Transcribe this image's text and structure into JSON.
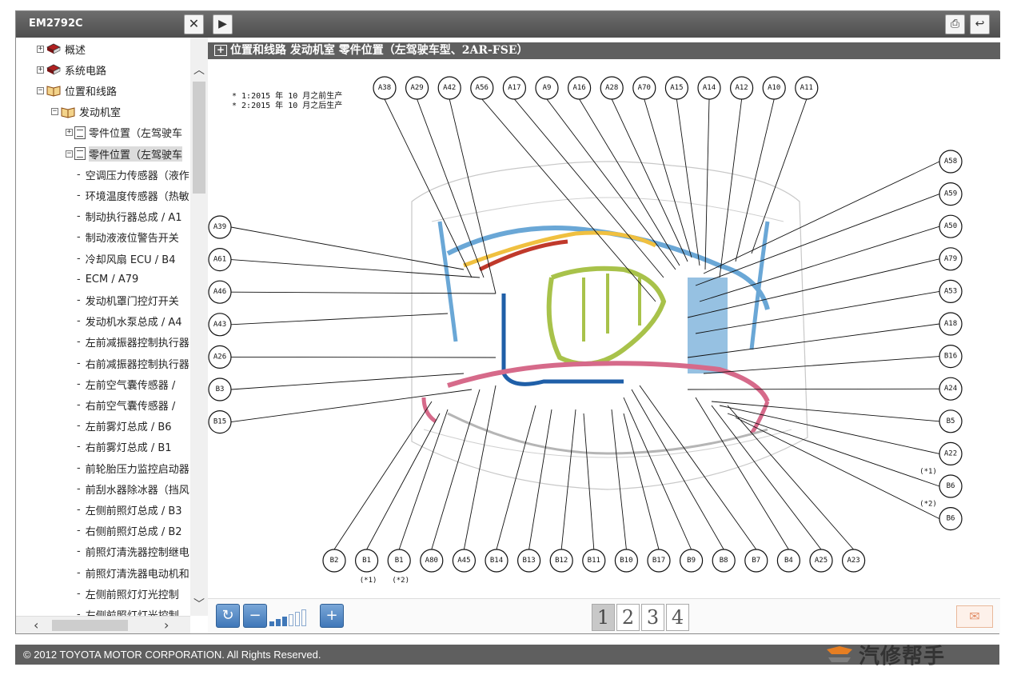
{
  "app": {
    "panel_title": "EM2792C",
    "close_glyph": "✕",
    "play_glyph": "▶",
    "print_glyph": "⎙",
    "back_glyph": "↩"
  },
  "tree": {
    "nodes": [
      {
        "label": "概述",
        "expander": "+",
        "icon": "book",
        "indent": 0
      },
      {
        "label": "系统电路",
        "expander": "+",
        "icon": "book",
        "indent": 0
      },
      {
        "label": "位置和线路",
        "expander": "-",
        "icon": "book-open",
        "indent": 0
      },
      {
        "label": "发动机室",
        "expander": "-",
        "icon": "book-open",
        "indent": 1
      },
      {
        "label": "零件位置（左驾驶车",
        "expander": "+",
        "icon": "doc",
        "indent": 2
      },
      {
        "label": "零件位置（左驾驶车",
        "expander": "-",
        "icon": "doc",
        "indent": 2,
        "selected": true
      },
      {
        "label": "空调压力传感器（液作",
        "icon": "dash",
        "indent": 3
      },
      {
        "label": "环境温度传感器（热敏",
        "icon": "dash",
        "indent": 3
      },
      {
        "label": "制动执行器总成 / A1",
        "icon": "dash",
        "indent": 3
      },
      {
        "label": "制动液液位警告开关",
        "icon": "dash",
        "indent": 3
      },
      {
        "label": "冷却风扇 ECU / B4",
        "icon": "dash",
        "indent": 3
      },
      {
        "label": "ECM / A79",
        "icon": "dash",
        "indent": 3
      },
      {
        "label": "发动机罩门控灯开关",
        "icon": "dash",
        "indent": 3
      },
      {
        "label": "发动机水泵总成 / A4",
        "icon": "dash",
        "indent": 3
      },
      {
        "label": "左前减振器控制执行器",
        "icon": "dash",
        "indent": 3
      },
      {
        "label": "右前减振器控制执行器",
        "icon": "dash",
        "indent": 3
      },
      {
        "label": "左前空气囊传感器 /",
        "icon": "dash",
        "indent": 3
      },
      {
        "label": "右前空气囊传感器 /",
        "icon": "dash",
        "indent": 3
      },
      {
        "label": "左前雾灯总成 / B6",
        "icon": "dash",
        "indent": 3
      },
      {
        "label": "右前雾灯总成 / B1",
        "icon": "dash",
        "indent": 3
      },
      {
        "label": "前轮胎压力监控启动器",
        "icon": "dash",
        "indent": 3
      },
      {
        "label": "前刮水器除冰器（挡风",
        "icon": "dash",
        "indent": 3
      },
      {
        "label": "左侧前照灯总成 / B3",
        "icon": "dash",
        "indent": 3
      },
      {
        "label": "右侧前照灯总成 / B2",
        "icon": "dash",
        "indent": 3
      },
      {
        "label": "前照灯清洗器控制继电",
        "icon": "dash",
        "indent": 3
      },
      {
        "label": "前照灯清洗器电动机和",
        "icon": "dash",
        "indent": 3
      },
      {
        "label": "左侧前照灯灯光控制",
        "icon": "dash",
        "indent": 3
      },
      {
        "label": "左侧前照灯灯光控制",
        "icon": "dash",
        "indent": 3
      }
    ]
  },
  "content": {
    "section_title": "位置和线路  发动机室  零件位置（左驾驶车型、2AR-FSE）",
    "plus_glyph": "+",
    "notes": [
      "* 1:2015 年 10 月之前生产",
      "* 2:2015 年 10 月之后生产"
    ]
  },
  "diagram": {
    "top": [
      "A38",
      "A29",
      "A42",
      "A56",
      "A17",
      "A9",
      "A16",
      "A28",
      "A70",
      "A15",
      "A14",
      "A12",
      "A10",
      "A11"
    ],
    "left": [
      "A39",
      "A61",
      "A46",
      "A43",
      "A26",
      "B3",
      "B15"
    ],
    "right": [
      "A58",
      "A59",
      "A50",
      "A79",
      "A53",
      "A18",
      "B16",
      "A24",
      "B5",
      "A22",
      "B6",
      "B6"
    ],
    "right_notes": [
      "",
      "",
      "",
      "",
      "",
      "",
      "",
      "",
      "",
      "",
      "(*1)",
      "(*2)"
    ],
    "bottom": [
      "B2",
      "B1",
      "B1",
      "A80",
      "A45",
      "B14",
      "B13",
      "B12",
      "B11",
      "B10",
      "B17",
      "B9",
      "B8",
      "B7",
      "B4",
      "A25",
      "A23"
    ],
    "bottom_notes": [
      "",
      "(*1)",
      "(*2)",
      "",
      "",
      "",
      "",
      "",
      "",
      "",
      "",
      "",
      "",
      "",
      "",
      "",
      ""
    ],
    "colors": {
      "harness_blue": "#6aa7d6",
      "harness_dark_blue": "#1f5fa8",
      "harness_green": "#a8c24a",
      "harness_pink": "#d66a8a",
      "harness_yellow": "#f0c040",
      "harness_red": "#c0392b",
      "outline": "#9a9a9a"
    }
  },
  "toolbar": {
    "refresh_glyph": "↻",
    "zoom_out_glyph": "−",
    "zoom_in_glyph": "+",
    "zoom_level": 0.5,
    "pages": [
      "1",
      "2",
      "3",
      "4"
    ],
    "active_page": "1",
    "comment_glyph": "✉"
  },
  "footer": {
    "copyright": "© 2012 TOYOTA MOTOR CORPORATION. All Rights Reserved.",
    "watermark": "汽修帮手"
  }
}
